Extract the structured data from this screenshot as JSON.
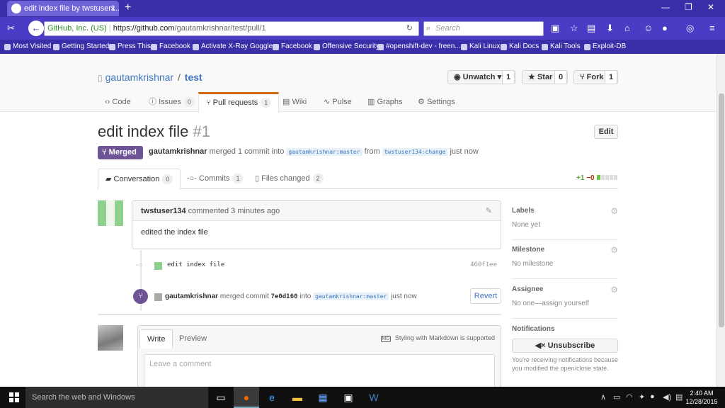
{
  "browser": {
    "tab_title": "edit index file by twstuser1...",
    "tab_close": "×",
    "new_tab": "+",
    "url_cert": "GitHub, Inc. (US)",
    "url_host": "https://github.com",
    "url_path": "/gautamkrishnar/test/pull/1",
    "search_placeholder": "Search",
    "bookmarks": [
      "Most Visited",
      "Getting Started",
      "Press This",
      "Facebook",
      "Activate X-Ray Goggles",
      "Facebook",
      "Offensive Security",
      "#openshift-dev - freen...",
      "Kali Linux",
      "Kali Docs",
      "Kali Tools",
      "Exploit-DB"
    ]
  },
  "repo": {
    "owner": "gautamkrishnar",
    "sep": "/",
    "name": "test",
    "watch_label": "Unwatch ▾",
    "watch_count": "1",
    "star_label": "Star",
    "star_count": "0",
    "fork_label": "Fork",
    "fork_count": "1",
    "nav": {
      "code": "Code",
      "issues": "Issues",
      "issues_count": "0",
      "pulls": "Pull requests",
      "pulls_count": "1",
      "wiki": "Wiki",
      "pulse": "Pulse",
      "graphs": "Graphs",
      "settings": "Settings"
    }
  },
  "pr": {
    "title": "edit index file",
    "number": "#1",
    "edit_label": "Edit",
    "state": "Merged",
    "author": "gautamkrishnar",
    "meta_1": "merged 1 commit into",
    "base_branch": "gautamkrishnar:master",
    "meta_2": "from",
    "head_branch": "twstuser134:change",
    "meta_3": "just now",
    "tabs": {
      "conversation": "Conversation",
      "conversation_count": "0",
      "commits": "Commits",
      "commits_count": "1",
      "files": "Files changed",
      "files_count": "2"
    },
    "additions": "+1",
    "deletions": "−0"
  },
  "comment": {
    "author": "twstuser134",
    "meta": "commented 3 minutes ago",
    "body": "edited the index file"
  },
  "commit": {
    "message": "edit index file",
    "sha": "460f1ee"
  },
  "merge_event": {
    "actor": "gautamkrishnar",
    "text_1": "merged commit",
    "sha": "7e0d160",
    "text_2": "into",
    "branch": "gautamkrishnar:master",
    "text_3": "just now",
    "revert_label": "Revert"
  },
  "editor": {
    "write_tab": "Write",
    "preview_tab": "Preview",
    "md_badge": "MD",
    "md_hint": "Styling with Markdown is supported",
    "placeholder": "Leave a comment"
  },
  "sidebar": {
    "labels_h": "Labels",
    "labels_v": "None yet",
    "milestone_h": "Milestone",
    "milestone_v": "No milestone",
    "assignee_h": "Assignee",
    "assignee_v": "No one—assign yourself",
    "notif_h": "Notifications",
    "unsubscribe": "Unsubscribe",
    "notif_note": "You're receiving notifications because you modified the open/close state."
  },
  "taskbar": {
    "search_placeholder": "Search the web and Windows",
    "time": "2:40 AM",
    "date": "12/28/2015"
  },
  "colors": {
    "browser_chrome": "#3a2fa8",
    "merged_purple": "#6e5494",
    "link_blue": "#4078c0",
    "tab_accent": "#d26911"
  }
}
